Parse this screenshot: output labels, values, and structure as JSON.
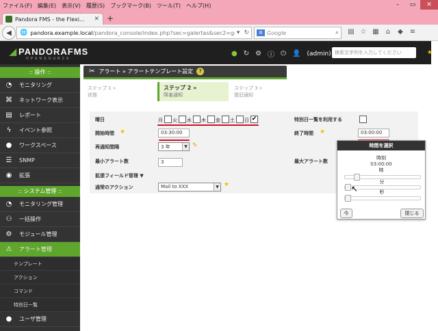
{
  "browser": {
    "menu": [
      "ファイル(F)",
      "編集(E)",
      "表示(V)",
      "履歴(S)",
      "ブックマーク(B)",
      "ツール(T)",
      "ヘルプ(H)"
    ],
    "tab_title": "Pandora FMS - the Flexi...",
    "url_host": "pandora.example.local",
    "url_path": "/pandora_console/index.php?sec=galertas&sec2=godm",
    "search_placeholder": "Google"
  },
  "header": {
    "logo": "PANDORAFMS",
    "logo_sub": "OPENSOURCE",
    "user": "(admin)",
    "search_placeholder": "検索文字列を入力してください"
  },
  "sidebar": {
    "section_ops": ":: 操作 ::",
    "ops_items": [
      {
        "label": "モニタリング",
        "icon": "monitor-icon"
      },
      {
        "label": "ネットワーク表示",
        "icon": "network-icon"
      },
      {
        "label": "レポート",
        "icon": "report-icon"
      },
      {
        "label": "イベント参照",
        "icon": "event-icon"
      },
      {
        "label": "ワークスペース",
        "icon": "workspace-icon"
      },
      {
        "label": "SNMP",
        "icon": "snmp-icon"
      },
      {
        "label": "拡張",
        "icon": "extension-icon"
      }
    ],
    "section_admin": ":: システム管理 ::",
    "admin_items": [
      {
        "label": "モニタリング管理",
        "icon": "monitor-admin-icon"
      },
      {
        "label": "一括操作",
        "icon": "bulk-icon"
      },
      {
        "label": "モジュール管理",
        "icon": "module-icon"
      },
      {
        "label": "アラート管理",
        "icon": "alert-icon"
      }
    ],
    "alert_sub": [
      "テンプレート",
      "アクション",
      "コマンド",
      "特別日一覧"
    ],
    "last_item": {
      "label": "ユーザ管理",
      "icon": "user-icon"
    }
  },
  "page": {
    "title": "アラート » アラートテンプレート設定",
    "steps": [
      {
        "name": "ステップ 1 »",
        "sub": "状態"
      },
      {
        "name": "ステップ 2 »",
        "sub": "障害通知"
      },
      {
        "name": "ステップ 3 »",
        "sub": "復旧通知"
      }
    ]
  },
  "form": {
    "days_label": "曜日",
    "days": [
      {
        "label": "月",
        "checked": false
      },
      {
        "label": "火",
        "checked": false
      },
      {
        "label": "水",
        "checked": false
      },
      {
        "label": "木",
        "checked": false
      },
      {
        "label": "金",
        "checked": false
      },
      {
        "label": "土",
        "checked": false
      },
      {
        "label": "日",
        "checked": true
      }
    ],
    "special_days_label": "特別日一覧を利用する",
    "start_time_label": "開始時間",
    "start_time": "03:30:00",
    "end_time_label": "終了時間",
    "end_time": "03:00:00",
    "renotify_label": "再通知間隔",
    "renotify_value": "3 年",
    "min_alerts_label": "最小アラート数",
    "min_alerts_value": "3",
    "max_alerts_label": "最大アラート数",
    "advanced_label": "拡張フィールド管理",
    "default_action_label": "通常のアクション",
    "default_action_value": "Mail to XXX"
  },
  "picker": {
    "title": "時間を選択",
    "time_label": "時刻",
    "time_value": "03:00:00",
    "hour_label": "時",
    "minute_label": "分",
    "second_label": "秒",
    "now_button": "今",
    "close_button": "閉じる",
    "hour": 3,
    "minute": 0,
    "second": 0
  }
}
